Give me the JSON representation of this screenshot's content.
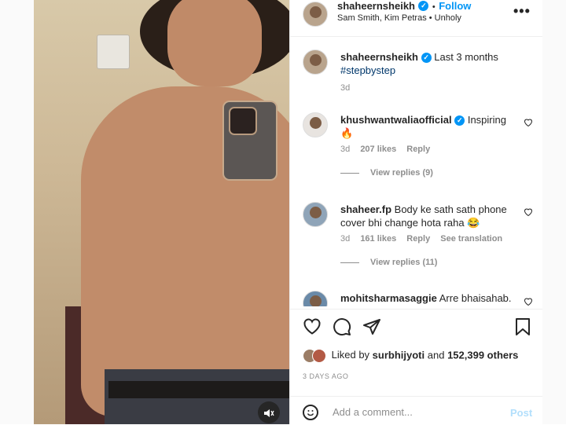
{
  "header": {
    "username": "shaheernsheikh",
    "follow_label": "Follow",
    "dot": "•",
    "audio": "Sam Smith, Kim Petras • Unholy",
    "more_label": "•••"
  },
  "caption": {
    "username": "shaheernsheikh",
    "text": "Last 3 months",
    "hashtag": "#stepbystep",
    "time": "3d"
  },
  "comments": [
    {
      "username": "khushwantwaliaofficial",
      "text": "Inspiring",
      "emoji": "🔥",
      "time": "3d",
      "likes": "207 likes",
      "reply_label": "Reply",
      "view_replies": "View replies (9)"
    },
    {
      "username": "shaheer.fp",
      "text": "Body ke sath sath phone cover bhi change hota raha 😂",
      "time": "3d",
      "likes": "161 likes",
      "reply_label": "Reply",
      "translation_label": "See translation",
      "view_replies": "View replies (11)"
    },
    {
      "username": "mohitsharmasaggie",
      "text": "Arre bhaisahab."
    }
  ],
  "likes_line": {
    "prefix": "Liked by",
    "user": "surbhijyoti",
    "mid": "and",
    "others": "152,399 others"
  },
  "date": "3 DAYS AGO",
  "comment_box": {
    "placeholder": "Add a comment...",
    "post_label": "Post"
  },
  "icons": {
    "mute": "muted-speaker-icon",
    "like": "heart-icon",
    "comment": "comment-bubble-icon",
    "share": "paper-plane-icon",
    "save": "bookmark-icon",
    "emoji": "smiley-icon",
    "verified": "verified-badge-icon"
  },
  "colors": {
    "accent": "#0095f6",
    "text": "#262626",
    "muted": "#8e8e8e",
    "post_disabled": "#b2dffc"
  }
}
